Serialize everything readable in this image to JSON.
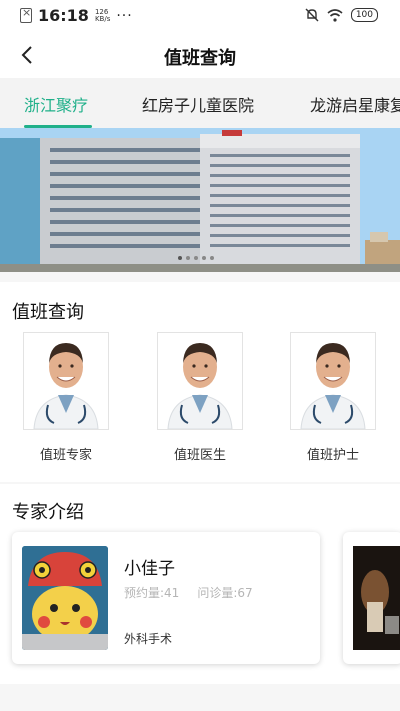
{
  "status_bar": {
    "time": "16:18",
    "net_speed_value": "126",
    "net_speed_unit": "KB/s",
    "more": "···",
    "battery": "100"
  },
  "header": {
    "title": "值班查询"
  },
  "tabs": [
    {
      "label": "浙江聚疗",
      "active": true
    },
    {
      "label": "红房子儿童医院",
      "active": false
    },
    {
      "label": "龙游启星康复",
      "active": false
    }
  ],
  "duty_section": {
    "title": "值班查询",
    "items": [
      {
        "label": "值班专家"
      },
      {
        "label": "值班医生"
      },
      {
        "label": "值班护士"
      }
    ]
  },
  "expert_section": {
    "title": "专家介绍",
    "experts": [
      {
        "name": "小佳子",
        "appointments_label": "预约量:41",
        "consultations_label": "问诊量:67",
        "specialty": "外科手术"
      }
    ]
  },
  "colors": {
    "accent": "#20b08a"
  }
}
